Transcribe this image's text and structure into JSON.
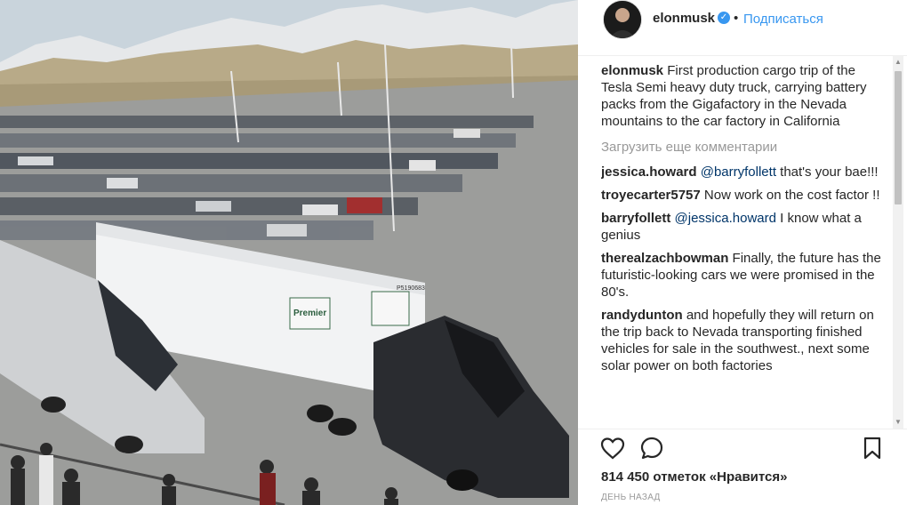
{
  "post": {
    "username": "elonmusk",
    "follow_label": "Подписаться",
    "separator": "•",
    "caption_user": "elonmusk",
    "caption_text": "First production cargo trip of the Tesla Semi heavy duty truck, carrying battery packs from the Gigafactory in the Nevada mountains to the car factory in California",
    "load_more": "Загрузить еще комментарии",
    "comments": [
      {
        "user": "jessica.howard",
        "mention": "@barryfollett",
        "text": " that's your bae!!!"
      },
      {
        "user": "troyecarter5757",
        "mention": "",
        "text": "Now work on the cost factor !!"
      },
      {
        "user": "barryfollett",
        "mention": "@jessica.howard",
        "text": " I know what a genius"
      },
      {
        "user": "therealzachbowman",
        "mention": "",
        "text": "Finally, the future has the futuristic-looking cars we were promised in the 80's."
      },
      {
        "user": "randydunton",
        "mention": "",
        "text": "and hopefully they will return on the trip back to Nevada transporting finished vehicles for sale in the southwest., next some solar power on both factories"
      }
    ],
    "likes_count": "814 450",
    "likes_suffix": "отметок «Нравится»",
    "timestamp": "ДЕНЬ НАЗАД",
    "trailer_brand": "Premier",
    "trailer_number": "P5190683"
  },
  "icons": {
    "verified": "verified-badge-icon",
    "like": "heart-icon",
    "comment": "comment-bubble-icon",
    "save": "bookmark-icon"
  },
  "colors": {
    "link": "#3897f0",
    "text": "#262626",
    "muted": "#999999",
    "mention": "#003569"
  }
}
